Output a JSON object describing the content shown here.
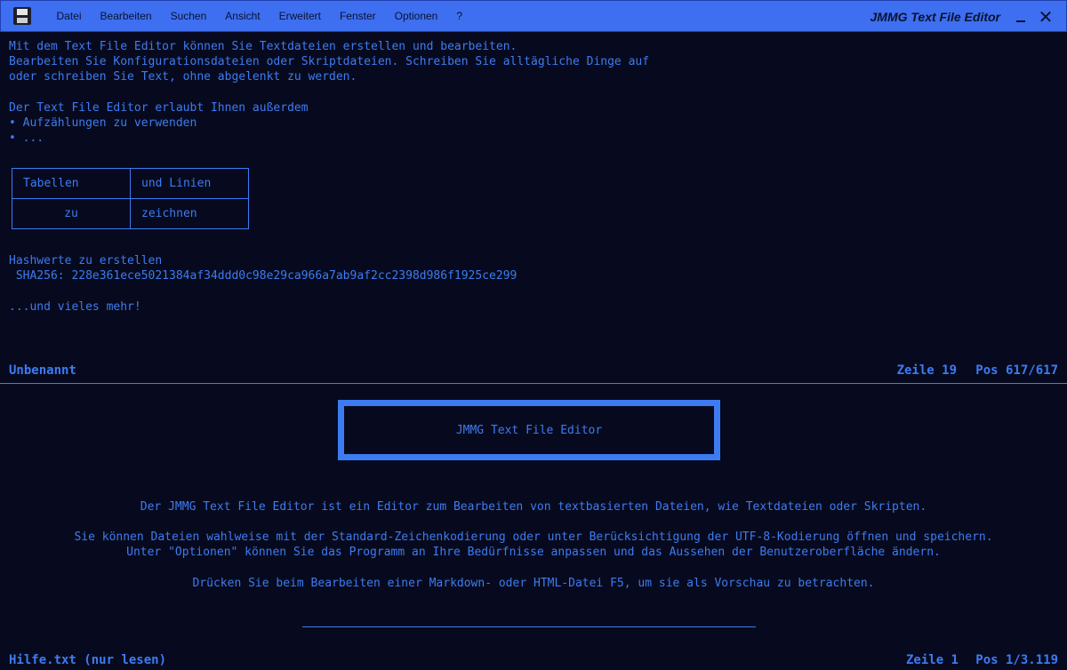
{
  "menu": [
    "Datei",
    "Bearbeiten",
    "Suchen",
    "Ansicht",
    "Erweitert",
    "Fenster",
    "Optionen",
    "?"
  ],
  "app_title": "JMMG Text File Editor",
  "window_controls": {
    "minimize": "—",
    "close": "✕"
  },
  "editor": {
    "lines": [
      "Mit dem Text File Editor können Sie Textdateien erstellen und bearbeiten.",
      "Bearbeiten Sie Konfigurationsdateien oder Skriptdateien. Schreiben Sie alltägliche Dinge auf",
      "oder schreiben Sie Text, ohne abgelenkt zu werden.",
      "Der Text File Editor erlaubt Ihnen außerdem",
      "• Aufzählungen zu verwenden",
      "• ...",
      "Hashwerte zu erstellen",
      " SHA256: 228e361ece5021384af34ddd0c98e29ca966a7ab9af2cc2398d986f1925ce299",
      "...und vieles mehr!"
    ],
    "table": [
      [
        "Tabellen",
        "und Linien"
      ],
      [
        "zu",
        "zeichnen"
      ]
    ],
    "status": {
      "filename": "Unbenannt",
      "line": "Zeile 19",
      "pos": "Pos 617/617"
    }
  },
  "help": {
    "logo_text": "JMMG Text File Editor",
    "paragraphs": [
      "Der JMMG Text File Editor ist ein Editor zum Bearbeiten von textbasierten Dateien, wie Textdateien oder Skripten.",
      "Sie können Dateien wahlweise mit der Standard-Zeichenkodierung oder unter Berücksichtigung der UTF-8-Kodierung öffnen und speichern.",
      "Unter \"Optionen\" können Sie das Programm an Ihre Bedürfnisse anpassen und das Aussehen der Benutzeroberfläche ändern.",
      "Drücken Sie beim Bearbeiten einer Markdown- oder HTML-Datei F5, um sie als Vorschau zu betrachten."
    ],
    "status": {
      "filename": "Hilfe.txt (nur lesen)",
      "line": "Zeile 1",
      "pos": "Pos 1/3.119"
    }
  },
  "colors": {
    "background": "#070a1e",
    "accent": "#3d7bf2",
    "titlebar": "#3d6ff0"
  }
}
